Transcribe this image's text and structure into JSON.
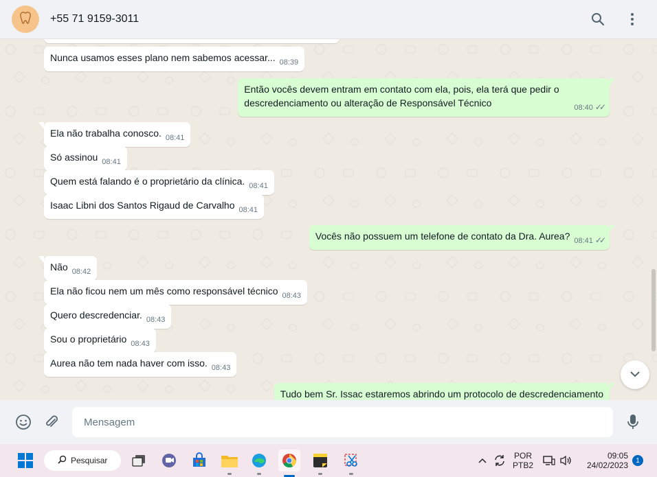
{
  "header": {
    "contact_name": "+55 71 9159-3011",
    "avatar_icon": "tooth-icon",
    "search_icon": "search-icon",
    "menu_icon": "more-vertical-icon"
  },
  "messages": [
    {
      "dir": "in",
      "text": "Nunca usamos esses plano nem sabemos acessar...",
      "time": "08:39"
    },
    {
      "dir": "out",
      "text": "Então vocês devem entram em contato com ela, pois, ela terá que pedir o",
      "text2": "descredenciamento ou alteração de Responsável Técnico",
      "time": "08:40",
      "status": "read"
    },
    {
      "dir": "in",
      "text": "Ela não trabalha conosco.",
      "time": "08:41"
    },
    {
      "dir": "in",
      "text": "Só assinou",
      "time": "08:41"
    },
    {
      "dir": "in",
      "text": "Quem está falando é o proprietário da clínica.",
      "time": "08:41"
    },
    {
      "dir": "in",
      "text": "Isaac Libni dos Santos Rigaud de Carvalho",
      "time": "08:41"
    },
    {
      "dir": "out",
      "text": "Vocês não possuem um telefone de contato da Dra. Aurea?",
      "time": "08:41",
      "status": "read"
    },
    {
      "dir": "in",
      "text": "Não",
      "time": "08:42"
    },
    {
      "dir": "in",
      "text": "Ela não ficou nem um mês como responsável técnico",
      "time": "08:43"
    },
    {
      "dir": "in",
      "text": "Quero descredenciar.",
      "time": "08:43"
    },
    {
      "dir": "in",
      "text": "Sou o proprietário",
      "time": "08:43"
    },
    {
      "dir": "in",
      "text": "Aurea não tem nada haver com isso.",
      "time": "08:43"
    },
    {
      "dir": "out",
      "text": "Tudo bem Sr. Issac estaremos abrindo um protocolo de descredenciamento",
      "time": "",
      "status": ""
    }
  ],
  "composer": {
    "placeholder": "Mensagem",
    "emoji_icon": "emoji-icon",
    "attach_icon": "paperclip-icon",
    "mic_icon": "microphone-icon"
  },
  "taskbar": {
    "search_label": "Pesquisar",
    "lang_line1": "POR",
    "lang_line2": "PTB2",
    "time": "09:05",
    "date": "24/02/2023",
    "notification_count": "1",
    "apps": [
      "windows-start-icon",
      "task-view-icon",
      "teams-chat-icon",
      "microsoft-store-icon",
      "file-explorer-icon",
      "edge-icon",
      "chrome-icon",
      "sticky-notes-icon",
      "snipping-tool-icon"
    ]
  },
  "colors": {
    "chat_bg": "#efeae2",
    "incoming_bubble": "#ffffff",
    "outgoing_bubble": "#d9fdd3",
    "read_tick": "#667781",
    "header_bg": "#f0f2f5",
    "taskbar_bg": "#f3e6ec"
  }
}
